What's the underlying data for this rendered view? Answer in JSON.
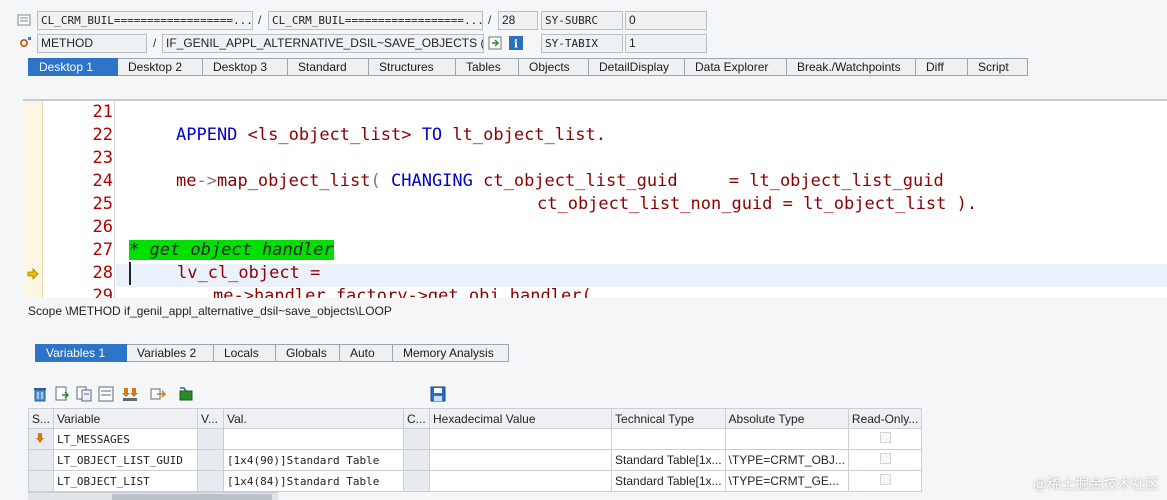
{
  "header": {
    "program1": "CL_CRM_BUIL==================...",
    "program2": "CL_CRM_BUIL==================...",
    "line_number": "28",
    "sy_subrc_label": "SY-SUBRC",
    "sy_subrc_value": "0",
    "event_type": "METHOD",
    "event_name": "IF_GENIL_APPL_ALTERNATIVE_DSIL~SAVE_OBJECTS (...",
    "sy_tabix_label": "SY-TABIX",
    "sy_tabix_value": "1",
    "separator": "/"
  },
  "desktop_tabs": [
    "Desktop 1",
    "Desktop 2",
    "Desktop 3",
    "Standard",
    "Structures",
    "Tables",
    "Objects",
    "DetailDisplay",
    "Data Explorer",
    "Break./Watchpoints",
    "Diff",
    "Script"
  ],
  "editor": {
    "line_numbers": [
      "21",
      "22",
      "23",
      "24",
      "25",
      "26",
      "27",
      "28",
      "29"
    ],
    "lines": {
      "l22_kw1": "APPEND",
      "l22_rest": "<ls_object_list>",
      "l22_kw2": "TO",
      "l22_tail": "lt_object_list.",
      "l24_a": "me",
      "l24_op": "->",
      "l24_b": "map_object_list",
      "l24_paren": "(",
      "l24_kw": "CHANGING",
      "l24_c": "ct_object_list_guid     = lt_object_list_guid",
      "l25_c": "ct_object_list_non_guid = lt_object_list",
      "l25_end": ").",
      "l27_comment": "* get object handler",
      "l28": "lv_cl_object =",
      "l29": "me->handler_factory->get_obj_handler("
    }
  },
  "scope_text": "Scope \\METHOD if_genil_appl_alternative_dsil~save_objects\\LOOP",
  "variable_tabs": [
    "Variables 1",
    "Variables 2",
    "Locals",
    "Globals",
    "Auto",
    "Memory Analysis"
  ],
  "table": {
    "columns": [
      "S...",
      "Variable",
      "V...",
      "Val.",
      "C...",
      "Hexadecimal Value",
      "Technical Type",
      "Absolute Type",
      "Read-Only..."
    ],
    "rows": [
      {
        "variable": "LT_MESSAGES",
        "val": "",
        "tech": "",
        "abs": ""
      },
      {
        "variable": "LT_OBJECT_LIST_GUID",
        "val": "[1x4(90)]Standard Table",
        "tech": "Standard Table[1x...",
        "abs": "\\TYPE=CRMT_OBJ..."
      },
      {
        "variable": "LT_OBJECT_LIST",
        "val": "[1x4(84)]Standard Table",
        "tech": "Standard Table[1x...",
        "abs": "\\TYPE=CRMT_GE..."
      }
    ]
  },
  "watermark": "@稀土掘金技术社区",
  "colors": {
    "active_tab": "#2d73c8",
    "comment_bg": "#00e000",
    "keyword": "#0000cc",
    "identifier": "#8b0000",
    "line_number": "#b00000"
  }
}
